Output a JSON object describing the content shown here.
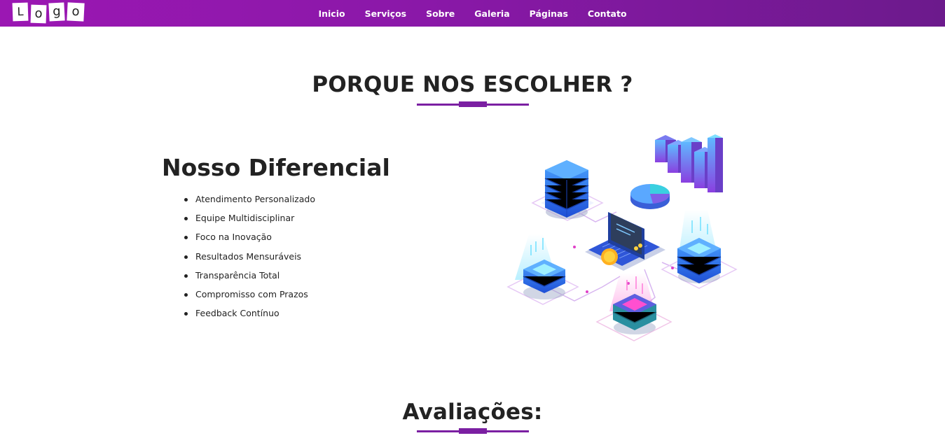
{
  "header": {
    "logo_letters": [
      "L",
      "o",
      "g",
      "o"
    ],
    "nav": [
      "Inicio",
      "Serviços",
      "Sobre",
      "Galeria",
      "Páginas",
      "Contato"
    ]
  },
  "why": {
    "title": "PORQUE NOS ESCOLHER ?",
    "subtitle": "Nosso Diferencial",
    "items": [
      "Atendimento Personalizado",
      "Equipe Multidisciplinar",
      "Foco na Inovação",
      "Resultados Mensuráveis",
      "Transparência Total",
      "Compromisso com Prazos",
      "Feedback Contínuo"
    ]
  },
  "reviews": {
    "title": "Avaliações:"
  },
  "colors": {
    "accent": "#7b1fa2",
    "nav_start": "#9b17b3",
    "nav_end": "#6c1a8c"
  },
  "icons": [
    "servers-data-illustration"
  ]
}
